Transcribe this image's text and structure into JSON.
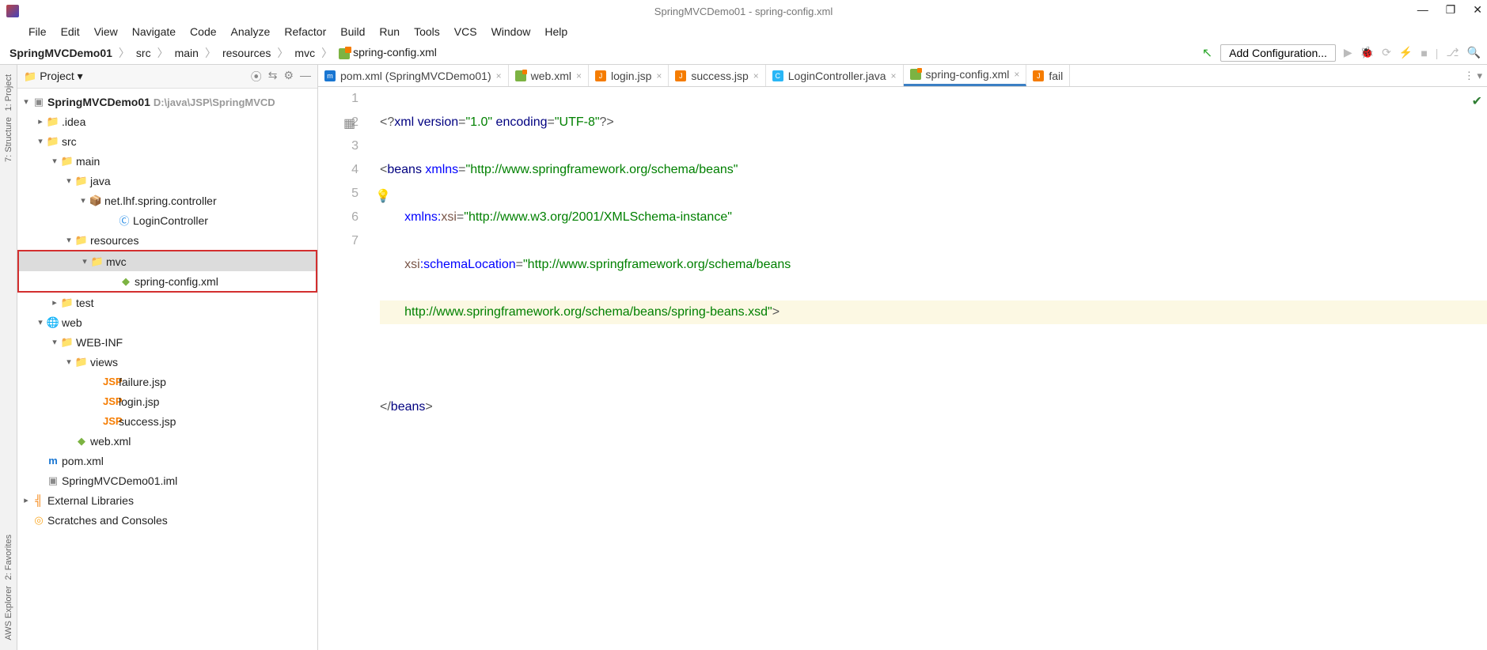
{
  "window_title": "SpringMVCDemo01 - spring-config.xml",
  "menu": [
    "File",
    "Edit",
    "View",
    "Navigate",
    "Code",
    "Analyze",
    "Refactor",
    "Build",
    "Run",
    "Tools",
    "VCS",
    "Window",
    "Help"
  ],
  "breadcrumbs": [
    "SpringMVCDemo01",
    "src",
    "main",
    "resources",
    "mvc",
    "spring-config.xml"
  ],
  "add_configuration": "Add Configuration...",
  "project_pane": {
    "title": "Project"
  },
  "tree": {
    "root": "SpringMVCDemo01",
    "root_path": "D:\\java\\JSP\\SpringMVCD",
    "idea": ".idea",
    "src": "src",
    "main": "main",
    "java": "java",
    "pkg": "net.lhf.spring.controller",
    "login_controller": "LoginController",
    "resources": "resources",
    "mvc": "mvc",
    "spring_config": "spring-config.xml",
    "test": "test",
    "web": "web",
    "web_inf": "WEB-INF",
    "views": "views",
    "failure": "failure.jsp",
    "login": "login.jsp",
    "success": "success.jsp",
    "web_xml": "web.xml",
    "pom": "pom.xml",
    "iml": "SpringMVCDemo01.iml",
    "ext_libs": "External Libraries",
    "scratches": "Scratches and Consoles"
  },
  "tabs": [
    {
      "label": "pom.xml (SpringMVCDemo01)",
      "active": false,
      "icon": "m"
    },
    {
      "label": "web.xml",
      "active": false,
      "icon": "xml"
    },
    {
      "label": "login.jsp",
      "active": false,
      "icon": "jsp"
    },
    {
      "label": "success.jsp",
      "active": false,
      "icon": "jsp"
    },
    {
      "label": "LoginController.java",
      "active": false,
      "icon": "java"
    },
    {
      "label": "spring-config.xml",
      "active": true,
      "icon": "xml"
    },
    {
      "label": "fail",
      "active": false,
      "icon": "jsp"
    }
  ],
  "gutter": [
    "1",
    "2",
    "3",
    "4",
    "5",
    "6",
    "7"
  ],
  "code": {
    "l1_a": "<?",
    "l1_b": "xml version",
    "l1_c": "=",
    "l1_d": "\"1.0\"",
    "l1_e": " encoding",
    "l1_f": "=",
    "l1_g": "\"UTF-8\"",
    "l1_h": "?>",
    "l2_a": "<",
    "l2_b": "beans ",
    "l2_c": "xmlns",
    "l2_d": "=",
    "l2_e": "\"http://www.springframework.org/schema/beans\"",
    "l3_pad": "       ",
    "l3_a": "xmlns:",
    "l3_b": "xsi",
    "l3_c": "=",
    "l3_d": "\"http://www.w3.org/2001/XMLSchema-instance\"",
    "l4_pad": "       ",
    "l4_a": "xsi",
    "l4_b": ":schemaLocation",
    "l4_c": "=",
    "l4_d": "\"http://www.springframework.org/schema/beans",
    "l5_pad": "       ",
    "l5_a": "http://www.springframework.org/schema/beans/spring-beans.xsd\"",
    "l5_b": ">",
    "l6": "",
    "l7_a": "</",
    "l7_b": "beans",
    "l7_c": ">"
  },
  "left_rail": {
    "project": "1: Project",
    "structure": "7: Structure",
    "fav": "2: Favorites",
    "aws": "AWS Explorer"
  }
}
